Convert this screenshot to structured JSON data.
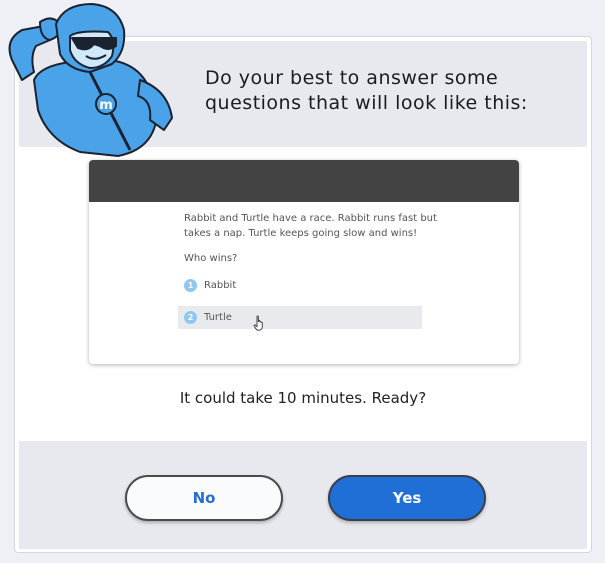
{
  "header": {
    "title": "Do your best to answer some\nquestions that will look like this:"
  },
  "preview": {
    "passage": "Rabbit and Turtle have a race. Rabbit runs fast but\ntakes a nap. Turtle keeps going slow and wins!",
    "question": "Who wins?",
    "options": [
      {
        "number": "1",
        "label": "Rabbit",
        "selected": false
      },
      {
        "number": "2",
        "label": "Turtle",
        "selected": true
      }
    ]
  },
  "prompt": "It could take 10 minutes. Ready?",
  "buttons": {
    "no_label": "No",
    "yes_label": "Yes"
  },
  "mascot": {
    "badge_letter": "m"
  },
  "colors": {
    "accent": "#1f6fd6",
    "mascot_blue": "#4aa3e8",
    "band": "#e7e9ef"
  }
}
